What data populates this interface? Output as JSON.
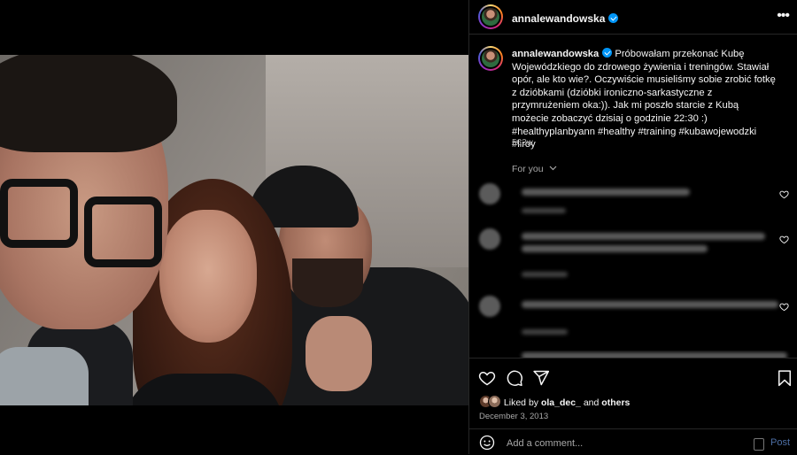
{
  "post": {
    "username": "annalewandowska",
    "verified": true,
    "more_icon": "more-horizontal-icon"
  },
  "caption": {
    "username": "annalewandowska",
    "text": "Próbowałam przekonać Kubę Wojewódzkiego do zdrowego żywienia i treningów. Stawiał opór, ale kto wie?. Oczywiście musieliśmy sobie zrobić fotkę z dzióbkami (dzióbki ironiczno-sarkastyczne z przymrużeniem oka:)). Jak mi poszło starcie z Kubą możecie zobaczyć dzisiaj o godzinie 22:30 :) #healthyplanbyann #healthy #training #kubawojewodzki #liroy",
    "time": "562w"
  },
  "comments": {
    "filter_label": "For you",
    "items": [
      {
        "blurred": true,
        "liked_icon": "heart-outline-icon"
      },
      {
        "blurred": true,
        "liked_icon": "heart-outline-icon"
      },
      {
        "blurred": true,
        "liked_icon": "heart-outline-icon"
      },
      {
        "blurred": true,
        "liked_icon": "heart-outline-icon"
      }
    ]
  },
  "actions": {
    "like_icon": "heart-icon",
    "comment_icon": "comment-icon",
    "share_icon": "send-icon",
    "save_icon": "bookmark-icon"
  },
  "likes": {
    "prefix": "Liked by",
    "user": "ola_dec_",
    "middle": "and",
    "others": "others"
  },
  "date": "December 3, 2013",
  "add_comment": {
    "placeholder": "Add a comment...",
    "post_label": "Post",
    "emoji_icon": "smiley-icon"
  },
  "colors": {
    "background": "#000000",
    "text": "#f5f5f5",
    "muted": "#a8a8a8",
    "verified": "#0095f6",
    "post_button": "#4c6ea4"
  }
}
